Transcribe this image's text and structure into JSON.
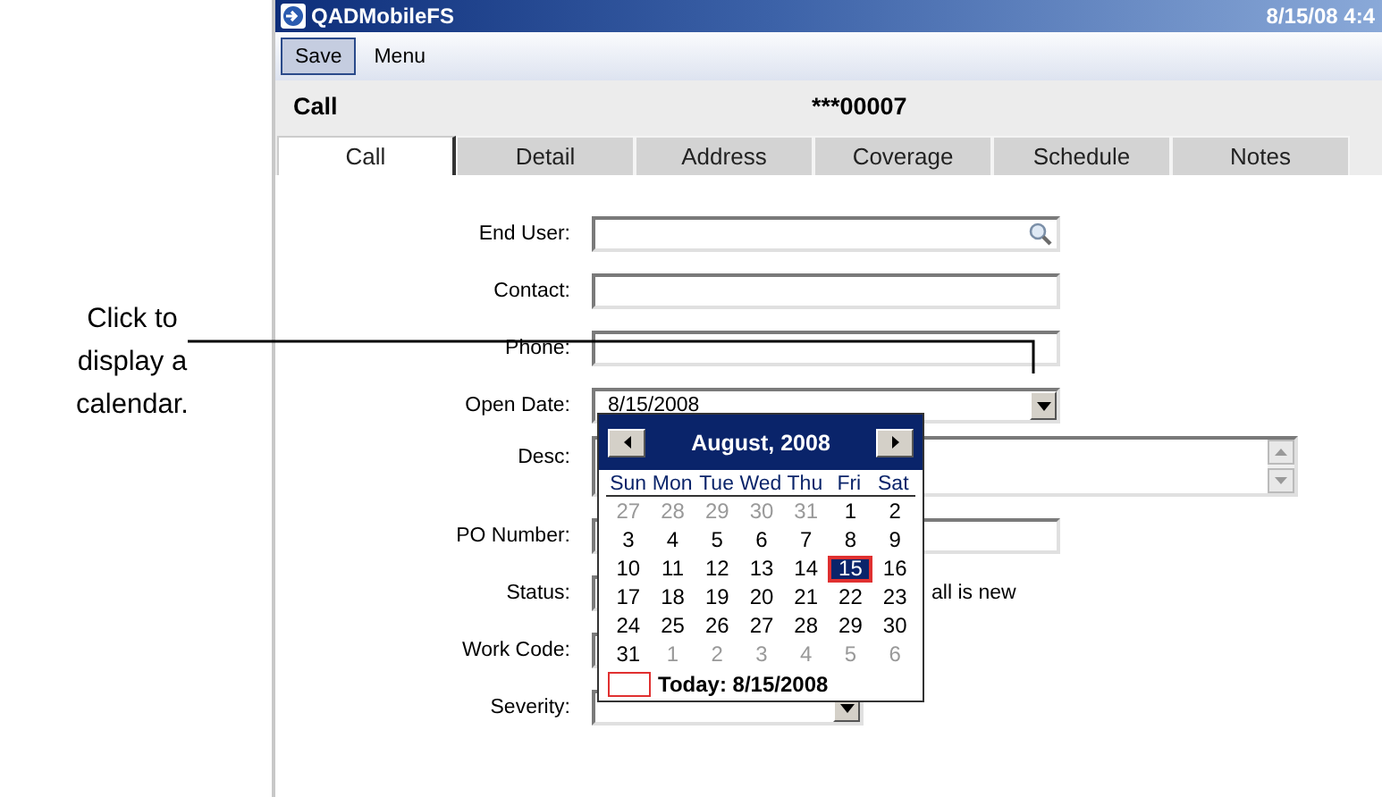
{
  "annotation": {
    "text": "Click to display a calendar."
  },
  "window": {
    "title": "QADMobileFS",
    "clock": "8/15/08 4:4"
  },
  "toolbar": [
    {
      "label": "Save",
      "kind": "button"
    },
    {
      "label": "Menu",
      "kind": "menu"
    }
  ],
  "header": {
    "title": "Call",
    "number": "***00007"
  },
  "tabs": [
    {
      "label": "Call",
      "selected": true
    },
    {
      "label": "Detail",
      "selected": false
    },
    {
      "label": "Address",
      "selected": false
    },
    {
      "label": "Coverage",
      "selected": false
    },
    {
      "label": "Schedule",
      "selected": false
    },
    {
      "label": "Notes",
      "selected": false
    }
  ],
  "fields": [
    {
      "label": "End User:",
      "kind": "search"
    },
    {
      "label": "Contact:",
      "kind": "text"
    },
    {
      "label": "Phone:",
      "kind": "text"
    },
    {
      "label": "Open Date:",
      "kind": "date",
      "value": "8/15/2008",
      "expanded": true
    },
    {
      "label": "Desc:",
      "kind": "textarea"
    },
    {
      "label": "PO Number:",
      "kind": "text"
    },
    {
      "label": "Status:",
      "kind": "select",
      "note": "all is new"
    },
    {
      "label": "Work Code:",
      "kind": "select"
    },
    {
      "label": "Severity:",
      "kind": "dropdown"
    }
  ],
  "calendar": {
    "month": "August, 2008",
    "weekdays": [
      "Sun",
      "Mon",
      "Tue",
      "Wed",
      "Thu",
      "Fri",
      "Sat"
    ],
    "days": [
      {
        "day": "27",
        "outside": true,
        "selected": false
      },
      {
        "day": "28",
        "outside": true,
        "selected": false
      },
      {
        "day": "29",
        "outside": true,
        "selected": false
      },
      {
        "day": "30",
        "outside": true,
        "selected": false
      },
      {
        "day": "31",
        "outside": true,
        "selected": false
      },
      {
        "day": "1",
        "outside": false,
        "selected": false
      },
      {
        "day": "2",
        "outside": false,
        "selected": false
      },
      {
        "day": "3",
        "outside": false,
        "selected": false
      },
      {
        "day": "4",
        "outside": false,
        "selected": false
      },
      {
        "day": "5",
        "outside": false,
        "selected": false
      },
      {
        "day": "6",
        "outside": false,
        "selected": false
      },
      {
        "day": "7",
        "outside": false,
        "selected": false
      },
      {
        "day": "8",
        "outside": false,
        "selected": false
      },
      {
        "day": "9",
        "outside": false,
        "selected": false
      },
      {
        "day": "10",
        "outside": false,
        "selected": false
      },
      {
        "day": "11",
        "outside": false,
        "selected": false
      },
      {
        "day": "12",
        "outside": false,
        "selected": false
      },
      {
        "day": "13",
        "outside": false,
        "selected": false
      },
      {
        "day": "14",
        "outside": false,
        "selected": false
      },
      {
        "day": "15",
        "outside": false,
        "selected": true
      },
      {
        "day": "16",
        "outside": false,
        "selected": false
      },
      {
        "day": "17",
        "outside": false,
        "selected": false
      },
      {
        "day": "18",
        "outside": false,
        "selected": false
      },
      {
        "day": "19",
        "outside": false,
        "selected": false
      },
      {
        "day": "20",
        "outside": false,
        "selected": false
      },
      {
        "day": "21",
        "outside": false,
        "selected": false
      },
      {
        "day": "22",
        "outside": false,
        "selected": false
      },
      {
        "day": "23",
        "outside": false,
        "selected": false
      },
      {
        "day": "24",
        "outside": false,
        "selected": false
      },
      {
        "day": "25",
        "outside": false,
        "selected": false
      },
      {
        "day": "26",
        "outside": false,
        "selected": false
      },
      {
        "day": "27",
        "outside": false,
        "selected": false
      },
      {
        "day": "28",
        "outside": false,
        "selected": false
      },
      {
        "day": "29",
        "outside": false,
        "selected": false
      },
      {
        "day": "30",
        "outside": false,
        "selected": false
      },
      {
        "day": "31",
        "outside": false,
        "selected": false
      },
      {
        "day": "1",
        "outside": true,
        "selected": false
      },
      {
        "day": "2",
        "outside": true,
        "selected": false
      },
      {
        "day": "3",
        "outside": true,
        "selected": false
      },
      {
        "day": "4",
        "outside": true,
        "selected": false
      },
      {
        "day": "5",
        "outside": true,
        "selected": false
      },
      {
        "day": "6",
        "outside": true,
        "selected": false
      }
    ],
    "today": "Today: 8/15/2008"
  }
}
